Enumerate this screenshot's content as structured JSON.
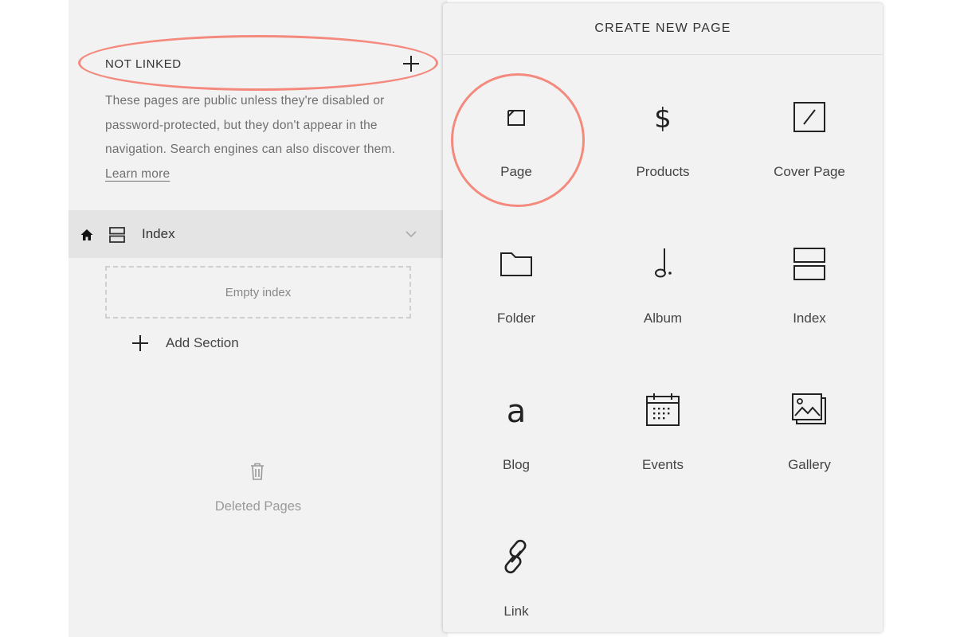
{
  "sidebar": {
    "not_linked": {
      "title": "NOT LINKED",
      "add_icon": "plus-icon",
      "description": "These pages are public unless they're disabled or password-protected, but they don't appear in the navigation. Search engines can also discover them.",
      "learn_more": "Learn more"
    },
    "index_item": {
      "label": "Index",
      "home_icon": "home-icon",
      "type_icon": "index-icon",
      "expand_icon": "chevron-down-icon"
    },
    "empty_index": "Empty index",
    "add_section": "Add Section",
    "deleted_pages": "Deleted Pages"
  },
  "create_panel": {
    "title": "CREATE NEW PAGE",
    "items": [
      {
        "label": "Page",
        "icon": "page-icon"
      },
      {
        "label": "Products",
        "icon": "dollar-icon"
      },
      {
        "label": "Cover Page",
        "icon": "cover-page-icon"
      },
      {
        "label": "Folder",
        "icon": "folder-icon"
      },
      {
        "label": "Album",
        "icon": "music-note-icon"
      },
      {
        "label": "Index",
        "icon": "index-icon"
      },
      {
        "label": "Blog",
        "icon": "blog-icon"
      },
      {
        "label": "Events",
        "icon": "calendar-icon"
      },
      {
        "label": "Gallery",
        "icon": "gallery-icon"
      },
      {
        "label": "Link",
        "icon": "link-icon"
      }
    ]
  },
  "colors": {
    "annotation": "#f48a7e",
    "sidebar_bg": "#f2f2f2",
    "selected_row_bg": "#e4e4e4"
  }
}
